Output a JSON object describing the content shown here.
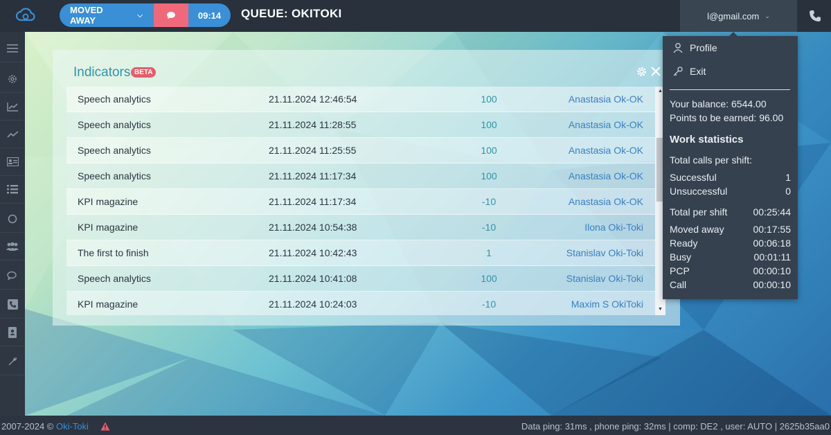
{
  "topbar": {
    "status_label": "MOVED AWAY",
    "timer": "09:14",
    "queue_title": "QUEUE: OKITOKI",
    "account_email": "l@gmail.com"
  },
  "indicators": {
    "title": "Indicators",
    "badge": "BETA",
    "rows": [
      {
        "name": "Speech analytics",
        "date": "21.11.2024 12:46:54",
        "value": "100",
        "user": "Anastasia Ok-OK"
      },
      {
        "name": "Speech analytics",
        "date": "21.11.2024 11:28:55",
        "value": "100",
        "user": "Anastasia Ok-OK"
      },
      {
        "name": "Speech analytics",
        "date": "21.11.2024 11:25:55",
        "value": "100",
        "user": "Anastasia Ok-OK"
      },
      {
        "name": "Speech analytics",
        "date": "21.11.2024 11:17:34",
        "value": "100",
        "user": "Anastasia Ok-OK"
      },
      {
        "name": "KPI magazine",
        "date": "21.11.2024 11:17:34",
        "value": "-10",
        "user": "Anastasia Ok-OK"
      },
      {
        "name": "KPI magazine",
        "date": "21.11.2024 10:54:38",
        "value": "-10",
        "user": "Ilona Oki-Toki"
      },
      {
        "name": "The first to finish",
        "date": "21.11.2024 10:42:43",
        "value": "1",
        "user": "Stanislav Oki-Toki"
      },
      {
        "name": "Speech analytics",
        "date": "21.11.2024 10:41:08",
        "value": "100",
        "user": "Stanislav Oki-Toki"
      },
      {
        "name": "KPI magazine",
        "date": "21.11.2024 10:24:03",
        "value": "-10",
        "user": "Maxim S OkiToki"
      }
    ]
  },
  "dropdown": {
    "profile": "Profile",
    "exit": "Exit",
    "balance": "Your balance: 6544.00",
    "points": "Points to be earned: 96.00",
    "work_stats_heading": "Work statistics",
    "total_calls_label": "Total calls per shift:",
    "stats": [
      {
        "label": "Successful",
        "value": "1"
      },
      {
        "label": "Unsuccessful",
        "value": "0"
      },
      {
        "label": "Total per shift",
        "value": "00:25:44"
      },
      {
        "label": "Moved away",
        "value": "00:17:55"
      },
      {
        "label": "Ready",
        "value": "00:06:18"
      },
      {
        "label": "Busy",
        "value": "00:01:11"
      },
      {
        "label": "PCP",
        "value": "00:00:10"
      },
      {
        "label": "Call",
        "value": "00:00:10"
      }
    ]
  },
  "footer": {
    "copyright": "2007-2024 © ",
    "brand_link": "Oki-Toki",
    "status": "Data ping: 31ms , phone ping: 32ms | comp: DE2 , user: AUTO | 2625b35aa0"
  },
  "colors": {
    "accent": "#3a8fd6",
    "alert": "#f0697a",
    "topbar": "#28313c",
    "dropdown": "#36414f"
  }
}
